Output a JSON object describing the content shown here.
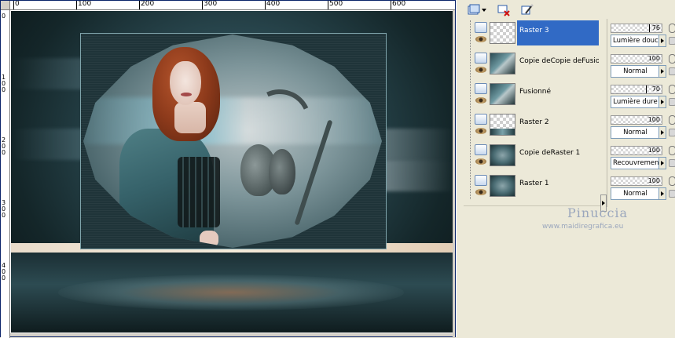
{
  "rulers": {
    "top_labels": [
      "0",
      "100",
      "200",
      "300",
      "400",
      "500",
      "600"
    ],
    "left_labels": [
      "0",
      "100",
      "200",
      "300",
      "400"
    ]
  },
  "toolbar": {
    "new_layer_icon": "new-raster-layer-icon",
    "delete_layer_icon": "delete-layer-icon",
    "edit_icon": "edit-brush-icon"
  },
  "layers": [
    {
      "name": "Raster 3",
      "selected": true,
      "opacity": "76",
      "blend": "Lumière douce"
    },
    {
      "name": "Copie deCopie deFusionné",
      "selected": false,
      "opacity": "100",
      "blend": "Normal"
    },
    {
      "name": "Fusionné",
      "selected": false,
      "opacity": "70",
      "blend": "Lumière dure"
    },
    {
      "name": "Raster 2",
      "selected": false,
      "opacity": "100",
      "blend": "Normal"
    },
    {
      "name": "Copie deRaster 1",
      "selected": false,
      "opacity": "100",
      "blend": "Recouvrement"
    },
    {
      "name": "Raster 1",
      "selected": false,
      "opacity": "100",
      "blend": "Normal"
    }
  ],
  "watermark": {
    "name": "Pinuccia",
    "url": "www.maidiregrafica.eu"
  },
  "colors": {
    "selection": "#316ac5",
    "panel_bg": "#ece9d8",
    "watermark": "#9ba7bd"
  }
}
